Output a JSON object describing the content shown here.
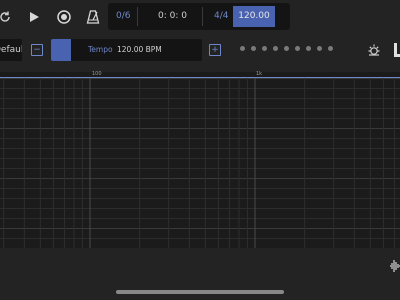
{
  "transport": {
    "track_count": "0/6",
    "position": "0: 0: 0",
    "time_signature": "4/4",
    "tempo": "120.00"
  },
  "toolbar2": {
    "preset_label": "Default",
    "tempo_label": "Tempo",
    "tempo_value": "120.00 BPM",
    "tempo_fill_fraction": 0.13,
    "page_dots": 9
  },
  "ruler": {
    "labels": [
      "100",
      "1k"
    ]
  },
  "icons": {
    "loop": "loop-icon",
    "play": "play-icon",
    "record": "record-icon",
    "metronome": "metronome-icon",
    "minus": "minus-icon",
    "plus": "plus-icon",
    "settings": "brightness-icon",
    "waveform": "waveform-icon"
  },
  "colors": {
    "accent": "#4a63b0",
    "accent_light": "#6e87c8",
    "background": "#232323",
    "panel": "#141414"
  }
}
